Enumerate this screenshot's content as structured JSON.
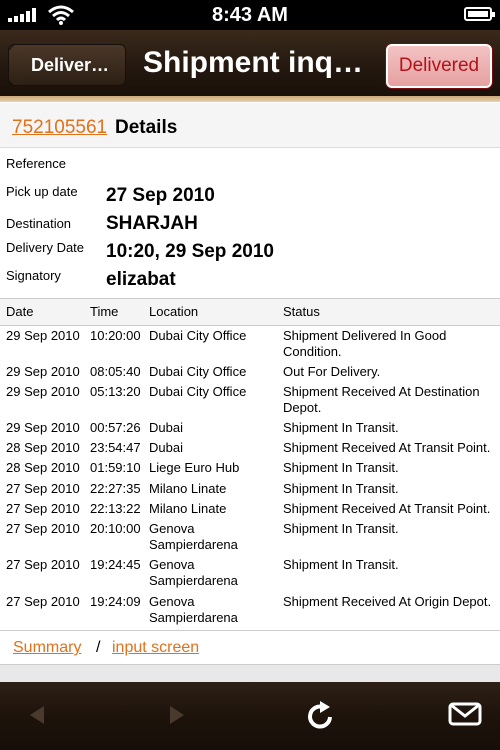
{
  "status_bar": {
    "time": "8:43 AM"
  },
  "nav": {
    "back_label": "Deliver…",
    "title": "Shipment inq…",
    "status_button": "Delivered"
  },
  "details": {
    "tracking_number": "752105561",
    "heading": "Details",
    "fields": [
      {
        "label": "Reference",
        "value": ""
      },
      {
        "label": "Pick up date",
        "value": "27 Sep 2010"
      },
      {
        "label": "Destination",
        "value": "SHARJAH"
      },
      {
        "label": "Delivery Date",
        "value": "10:20, 29 Sep 2010"
      },
      {
        "label": "Signatory",
        "value": "elizabat"
      }
    ]
  },
  "table": {
    "headers": [
      "Date",
      "Time",
      "Location",
      "Status"
    ],
    "rows": [
      {
        "date": "29 Sep 2010",
        "time": "10:20:00",
        "location": "Dubai City Office",
        "status": "Shipment Delivered In Good Condition."
      },
      {
        "date": "29 Sep 2010",
        "time": "08:05:40",
        "location": "Dubai City Office",
        "status": "Out For Delivery."
      },
      {
        "date": "29 Sep 2010",
        "time": "05:13:20",
        "location": "Dubai City Office",
        "status": "Shipment Received At Destination Depot."
      },
      {
        "date": "29 Sep 2010",
        "time": "00:57:26",
        "location": "Dubai",
        "status": "Shipment In Transit."
      },
      {
        "date": "28 Sep 2010",
        "time": "23:54:47",
        "location": "Dubai",
        "status": "Shipment Received At Transit Point."
      },
      {
        "date": "28 Sep 2010",
        "time": "01:59:10",
        "location": "Liege Euro Hub",
        "status": "Shipment In Transit."
      },
      {
        "date": "27 Sep 2010",
        "time": "22:27:35",
        "location": "Milano Linate",
        "status": "Shipment In Transit."
      },
      {
        "date": "27 Sep 2010",
        "time": "22:13:22",
        "location": "Milano Linate",
        "status": "Shipment Received At Transit Point."
      },
      {
        "date": "27 Sep 2010",
        "time": "20:10:00",
        "location": "Genova Sampierdarena",
        "status": "Shipment In Transit."
      },
      {
        "date": "27 Sep 2010",
        "time": "19:24:45",
        "location": "Genova Sampierdarena",
        "status": "Shipment In Transit."
      },
      {
        "date": "27 Sep 2010",
        "time": "19:24:09",
        "location": "Genova Sampierdarena",
        "status": "Shipment Received At Origin Depot."
      }
    ]
  },
  "footer": {
    "summary_link": "Summary",
    "separator": "/",
    "input_link": "input screen"
  },
  "toolbar": {
    "icons": [
      "back-arrow-icon",
      "forward-arrow-icon",
      "refresh-icon",
      "mail-icon"
    ]
  },
  "colors": {
    "link": "#e2711b",
    "delivered_text": "#b4121b",
    "nav_bg": "#24180f"
  }
}
